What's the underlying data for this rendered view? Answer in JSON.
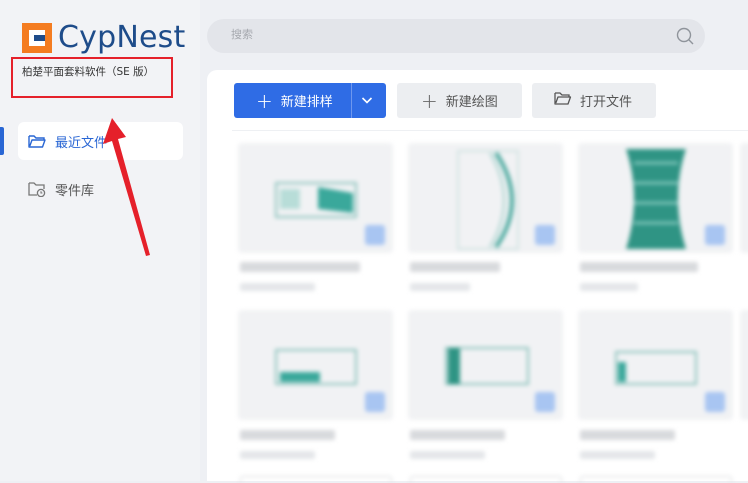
{
  "app": {
    "logo_text": "CypNest",
    "subtitle": "柏楚平面套料软件（SE 版）"
  },
  "sidebar": {
    "items": [
      {
        "label": "最近文件",
        "icon": "folder-open-icon",
        "active": true
      },
      {
        "label": "零件库",
        "icon": "folder-clock-icon",
        "active": false
      }
    ]
  },
  "search": {
    "placeholder": "搜索"
  },
  "toolbar": {
    "new_nest_label": "新建排样",
    "new_drawing_label": "新建绘图",
    "open_file_label": "打开文件"
  },
  "colors": {
    "accent": "#2f6ce5",
    "annotation_red": "#e5202a",
    "logo_blue": "#1e4c8a",
    "logo_orange": "#f47c20"
  }
}
